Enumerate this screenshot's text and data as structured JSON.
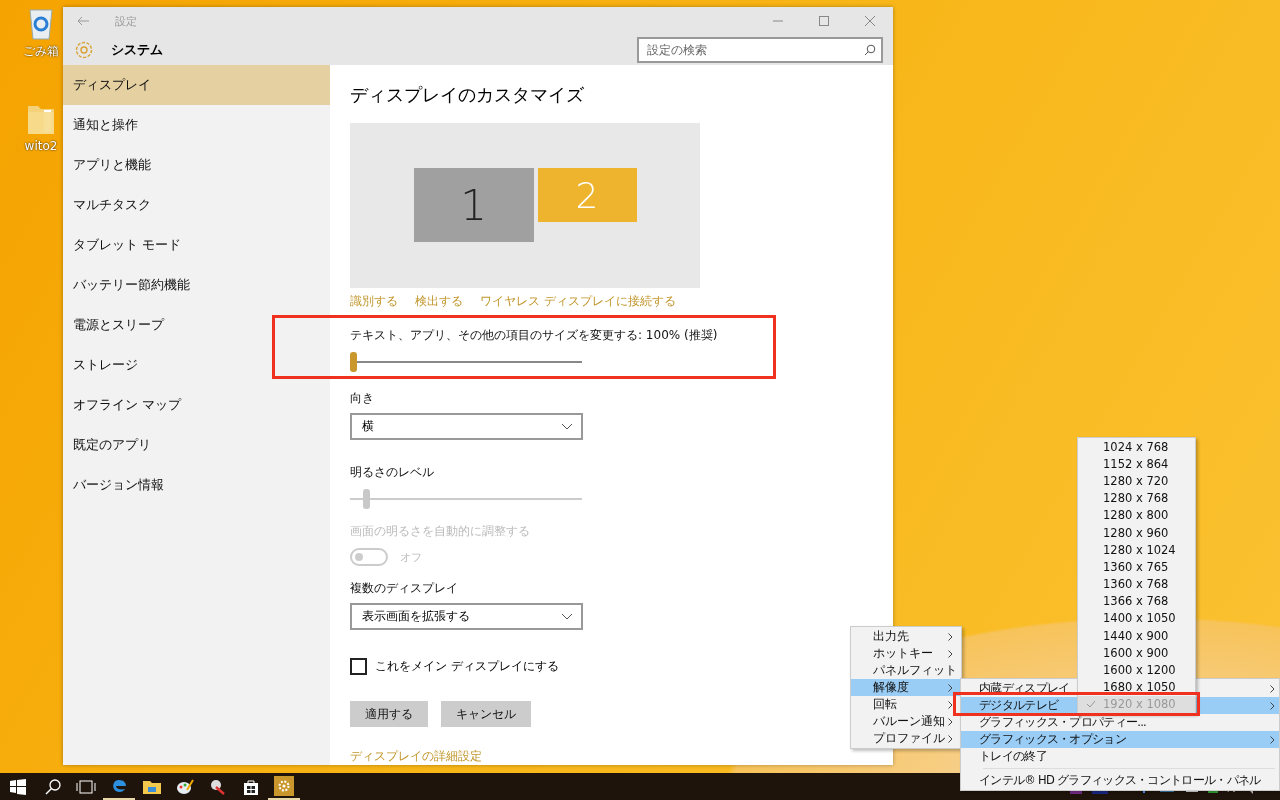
{
  "desktop_icons": [
    {
      "kind": "recycle",
      "label": "ごみ箱"
    },
    {
      "kind": "folder",
      "label": "wito2"
    }
  ],
  "window": {
    "title": "設定",
    "header": "システム",
    "search": {
      "placeholder": "設定の検索"
    }
  },
  "sidebar": {
    "items": [
      {
        "label": "ディスプレイ",
        "selected": true
      },
      {
        "label": "通知と操作",
        "selected": false
      },
      {
        "label": "アプリと機能",
        "selected": false
      },
      {
        "label": "マルチタスク",
        "selected": false
      },
      {
        "label": "タブレット モード",
        "selected": false
      },
      {
        "label": "バッテリー節約機能",
        "selected": false
      },
      {
        "label": "電源とスリープ",
        "selected": false
      },
      {
        "label": "ストレージ",
        "selected": false
      },
      {
        "label": "オフライン マップ",
        "selected": false
      },
      {
        "label": "既定のアプリ",
        "selected": false
      },
      {
        "label": "バージョン情報",
        "selected": false
      }
    ]
  },
  "content": {
    "heading": "ディスプレイのカスタマイズ",
    "displays": [
      {
        "label": "1",
        "selected": false
      },
      {
        "label": "2",
        "selected": true
      }
    ],
    "links": [
      "識別する",
      "検出する",
      "ワイヤレス ディスプレイに接続する"
    ],
    "scale": {
      "label": "テキスト、アプリ、その他の項目のサイズを変更する: 100% (推奨)",
      "level": 0,
      "highlighted": true
    },
    "orientation": {
      "label": "向き",
      "value": "横"
    },
    "brightness": {
      "label": "明るさのレベル",
      "level": 0.06,
      "disabled": true
    },
    "auto_brightness": {
      "label": "画面の明るさを自動的に調整する",
      "state": "オフ",
      "on": false,
      "disabled": true
    },
    "multiple_displays": {
      "label": "複数のディスプレイ",
      "value": "表示画面を拡張する"
    },
    "main_display": {
      "label": "これをメイン ディスプレイにする",
      "checked": false
    },
    "buttons": [
      "適用する",
      "キャンセル"
    ],
    "advanced_link": "ディスプレイの詳細設定"
  },
  "tray_menu": [
    {
      "label": "出力先",
      "selected": false
    },
    {
      "label": "ホットキー",
      "selected": false
    },
    {
      "label": "パネルフィット",
      "selected": false
    },
    {
      "label": "解像度",
      "selected": true
    },
    {
      "label": "回転",
      "selected": false
    },
    {
      "label": "バルーン通知",
      "selected": false
    },
    {
      "label": "プロファイル",
      "selected": false
    }
  ],
  "submenu": [
    {
      "kind": "item",
      "label": "内蔵ディスプレイ",
      "submenu": true,
      "selected": false,
      "highlighted": false
    },
    {
      "kind": "item",
      "label": "デジタルテレビ",
      "submenu": true,
      "selected": true,
      "highlighted": true
    },
    {
      "kind": "item",
      "label": "グラフィックス・プロパティー...",
      "submenu": false,
      "selected": false,
      "highlighted": false
    },
    {
      "kind": "item",
      "label": "グラフィックス・オプション",
      "submenu": true,
      "selected": true,
      "highlighted": false
    },
    {
      "kind": "item",
      "label": "トレイの終了",
      "submenu": false,
      "selected": false,
      "highlighted": false
    },
    {
      "kind": "separator"
    },
    {
      "kind": "item",
      "label": "インテル® HD グラフィックス・コントロール・パネル",
      "submenu": false,
      "selected": false,
      "highlighted": false
    }
  ],
  "resolutions": [
    {
      "label": "1024 x 768",
      "checked": false
    },
    {
      "label": "1152 x 864",
      "checked": false
    },
    {
      "label": "1280 x 720",
      "checked": false
    },
    {
      "label": "1280 x 768",
      "checked": false
    },
    {
      "label": "1280 x 800",
      "checked": false
    },
    {
      "label": "1280 x 960",
      "checked": false
    },
    {
      "label": "1280 x 1024",
      "checked": false
    },
    {
      "label": "1360 x 765",
      "checked": false
    },
    {
      "label": "1360 x 768",
      "checked": false
    },
    {
      "label": "1366 x 768",
      "checked": false
    },
    {
      "label": "1400 x 1050",
      "checked": false
    },
    {
      "label": "1440 x 900",
      "checked": false
    },
    {
      "label": "1600 x 900",
      "checked": false
    },
    {
      "label": "1600 x 1200",
      "checked": false
    },
    {
      "label": "1680 x 1050",
      "checked": false
    },
    {
      "label": "1920 x 1080",
      "checked": true
    }
  ],
  "taskbar": [
    {
      "kind": "start",
      "running": false
    },
    {
      "kind": "search",
      "running": false
    },
    {
      "kind": "taskview",
      "running": false
    },
    {
      "kind": "edge",
      "running": true
    },
    {
      "kind": "explorer",
      "running": false
    },
    {
      "kind": "paint",
      "running": false
    },
    {
      "kind": "tool",
      "running": false
    },
    {
      "kind": "store",
      "running": false
    },
    {
      "kind": "settings",
      "running": true
    }
  ]
}
